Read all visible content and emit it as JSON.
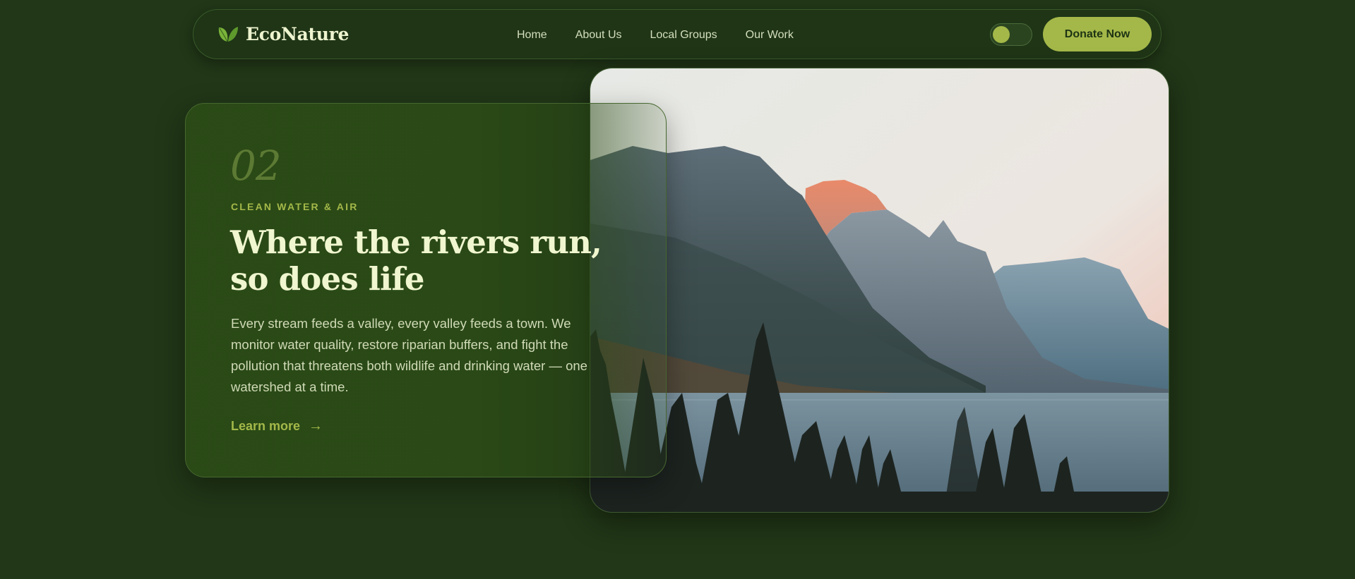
{
  "nav": {
    "brand": "EcoNature",
    "links": [
      "Home",
      "About Us",
      "Local Groups",
      "Our Work"
    ],
    "donate_label": "Donate Now"
  },
  "hero": {
    "number": "02",
    "eyebrow": "CLEAN WATER & AIR",
    "title": "Where the rivers run, so does life",
    "body": "Every stream feeds a valley, every valley feeds a town. We monitor water quality, restore riparian buffers, and fight the pollution that threatens both wildlife and drinking water — one watershed at a time.",
    "cta_label": "Learn more",
    "cta_arrow": "→"
  },
  "icons": {
    "logo": "leaf-icon",
    "cta": "arrow-right-icon"
  },
  "colors": {
    "background": "#213717",
    "nav_bg": "#1f3516",
    "card_bg": "#2a4a16",
    "accent": "#a4b849",
    "heading": "#f0f6cf",
    "body_text": "#d0dab7"
  }
}
